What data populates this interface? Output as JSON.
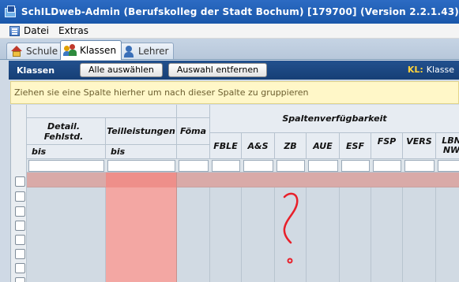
{
  "window": {
    "title": "SchILDweb-Admin   (Berufskolleg der Stadt Bochum) [179700]     (Version 2.2.1.43)"
  },
  "menu": {
    "items": [
      "Datei",
      "Extras"
    ]
  },
  "tabs": [
    {
      "label": "Schule",
      "icon": "house-icon",
      "active": false
    },
    {
      "label": "Klassen",
      "icon": "people-icon",
      "active": true
    },
    {
      "label": "Lehrer",
      "icon": "person-icon",
      "active": false
    }
  ],
  "toolbar": {
    "section_title": "Klassen",
    "select_all_label": "Alle auswählen",
    "deselect_label": "Auswahl entfernen",
    "kl_key": "KL:",
    "kl_value": "Klasse"
  },
  "group_hint": "Ziehen sie eine Spalte hierher um nach dieser Spalte zu gruppieren",
  "grid": {
    "columns": {
      "detail_fehlstd": "Detail. Fehlstd.",
      "teilleistungen": "Teilleistungen",
      "foema": "Föma",
      "spaltenverfuegbarkeit": "Spaltenverfügbarkeit",
      "fble": "FBLE",
      "as": "A&S",
      "zb": "ZB",
      "aue": "AUE",
      "esf": "ESF",
      "fsp": "FSP",
      "vers": "VERS",
      "lbn_line1": "LBN",
      "lbn_line2": "NW"
    },
    "sub_labels": {
      "detail_bis": "bis",
      "teil_bis": "bis"
    },
    "highlight_color": "#f3a7a3",
    "row_highlight_color": "#d9aaa8",
    "checkbox_rows": 8
  },
  "annotation": {
    "color": "#e8202a"
  }
}
